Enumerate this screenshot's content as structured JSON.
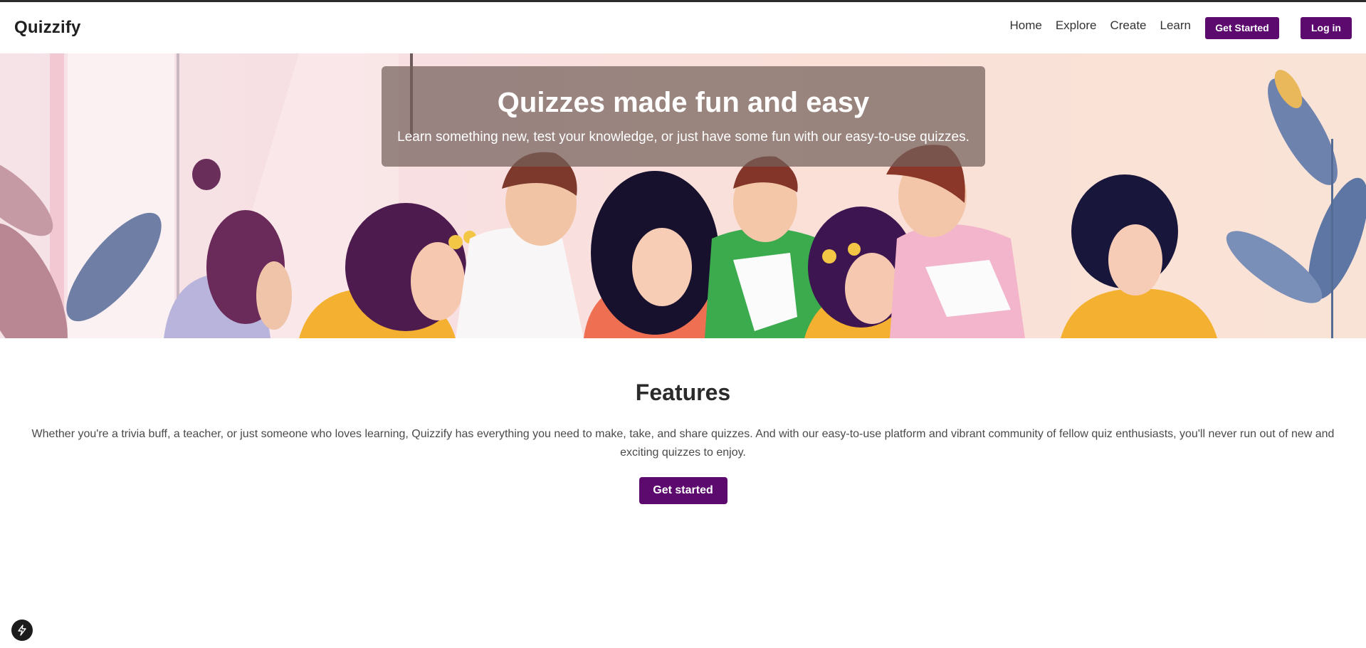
{
  "navbar": {
    "brand": "Quizzify",
    "links": [
      "Home",
      "Explore",
      "Create",
      "Learn"
    ],
    "get_started_label": "Get Started",
    "login_label": "Log in"
  },
  "hero": {
    "title": "Quizzes made fun and easy",
    "subtitle": "Learn something new, test your knowledge, or just have some fun with our easy-to-use quizzes.",
    "image_description_icon": "group-of-people-taking-quiz-illustration"
  },
  "features": {
    "title": "Features",
    "text": "Whether you're a trivia buff, a teacher, or just someone who loves learning, Quizzify has everything you need to make, take, and share quizzes. And with our easy-to-use platform and vibrant community of fellow quiz enthusiasts, you'll never run out of new and exciting quizzes to enjoy.",
    "button_label": "Get started"
  },
  "floating": {
    "icon": "bolt-icon"
  },
  "colors": {
    "accent": "#5c0a6e",
    "overlay": "#735f5a",
    "text": "#222222"
  }
}
